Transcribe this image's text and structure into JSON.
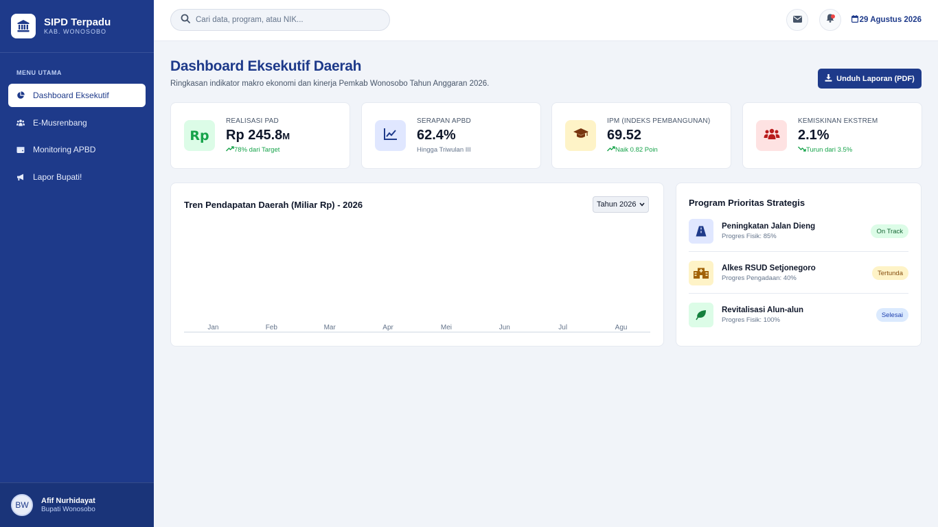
{
  "brand": {
    "title": "SIPD Terpadu",
    "subtitle": "KAB. WONOSOBO",
    "icon": "bank-icon"
  },
  "sidebar": {
    "caption": "MENU UTAMA",
    "items": [
      {
        "label": "Dashboard Eksekutif",
        "icon": "pie-chart-icon",
        "active": true
      },
      {
        "label": "E-Musrenbang",
        "icon": "people-icon",
        "active": false
      },
      {
        "label": "Monitoring APBD",
        "icon": "wallet-icon",
        "active": false
      },
      {
        "label": "Lapor Bupati!",
        "icon": "megaphone-icon",
        "active": false
      }
    ]
  },
  "user": {
    "initials": "BW",
    "name": "Afif Nurhidayat",
    "role": "Bupati Wonosobo"
  },
  "topbar": {
    "search_placeholder": "Cari data, program, atau NIK...",
    "date": "29 Agustus 2026"
  },
  "header": {
    "title": "Dashboard Eksekutif Daerah",
    "subtitle": "Ringkasan indikator makro ekonomi dan kinerja Pemkab Wonosobo Tahun Anggaran 2026.",
    "download_label": "Unduh Laporan (PDF)"
  },
  "stats": [
    {
      "label": "REALISASI PAD",
      "value": "Rp 245.8",
      "unit": "M",
      "note": "78% dari Target",
      "trend": "up",
      "icon": "rupiah-icon",
      "tile_color": "#dcfce7",
      "icon_color": "#16a34a"
    },
    {
      "label": "SERAPAN APBD",
      "value": "62.4%",
      "unit": "",
      "note": "Hingga Triwulan III",
      "trend": "none",
      "icon": "line-chart-icon",
      "tile_color": "#e0e7ff",
      "icon_color": "#1e3a8a"
    },
    {
      "label": "IPM (INDEKS PEMBANGUNAN)",
      "value": "69.52",
      "unit": "",
      "note": "Naik 0.82 Poin",
      "trend": "up",
      "icon": "graduation-cap-icon",
      "tile_color": "#fef3c7",
      "icon_color": "#78350f"
    },
    {
      "label": "KEMISKINAN EKSTREM",
      "value": "2.1%",
      "unit": "",
      "note": "Turun dari 3.5%",
      "trend": "down",
      "icon": "users-icon",
      "tile_color": "#fee2e2",
      "icon_color": "#b91c1c"
    }
  ],
  "chart_panel": {
    "title": "Tren Pendapatan Daerah (Miliar Rp) - 2026",
    "year_select": "Tahun 2026"
  },
  "chart_data": {
    "type": "bar",
    "categories": [
      "Jan",
      "Feb",
      "Mar",
      "Apr",
      "Mei",
      "Jun",
      "Jul",
      "Agu"
    ],
    "values": [],
    "title": "Tren Pendapatan Daerah (Miliar Rp) - 2026",
    "grid": false
  },
  "programs": {
    "title": "Program Prioritas Strategis",
    "items": [
      {
        "name": "Peningkatan Jalan Dieng",
        "detail": "Progres Fisik: 85%",
        "status": "On Track",
        "icon": "road-icon",
        "icon_bg": "#e0e7ff",
        "icon_color": "#1e3a8a",
        "badge_bg": "#dcfce7",
        "badge_color": "#166534"
      },
      {
        "name": "Alkes RSUD Setjonegoro",
        "detail": "Progres Pengadaan: 40%",
        "status": "Tertunda",
        "icon": "hospital-icon",
        "icon_bg": "#fef3c7",
        "icon_color": "#a16207",
        "badge_bg": "#fef3c7",
        "badge_color": "#854d0e"
      },
      {
        "name": "Revitalisasi Alun-alun",
        "detail": "Progres Fisik: 100%",
        "status": "Selesai",
        "icon": "leaf-icon",
        "icon_bg": "#dcfce7",
        "icon_color": "#15803d",
        "badge_bg": "#dbeafe",
        "badge_color": "#1e40af"
      }
    ]
  }
}
